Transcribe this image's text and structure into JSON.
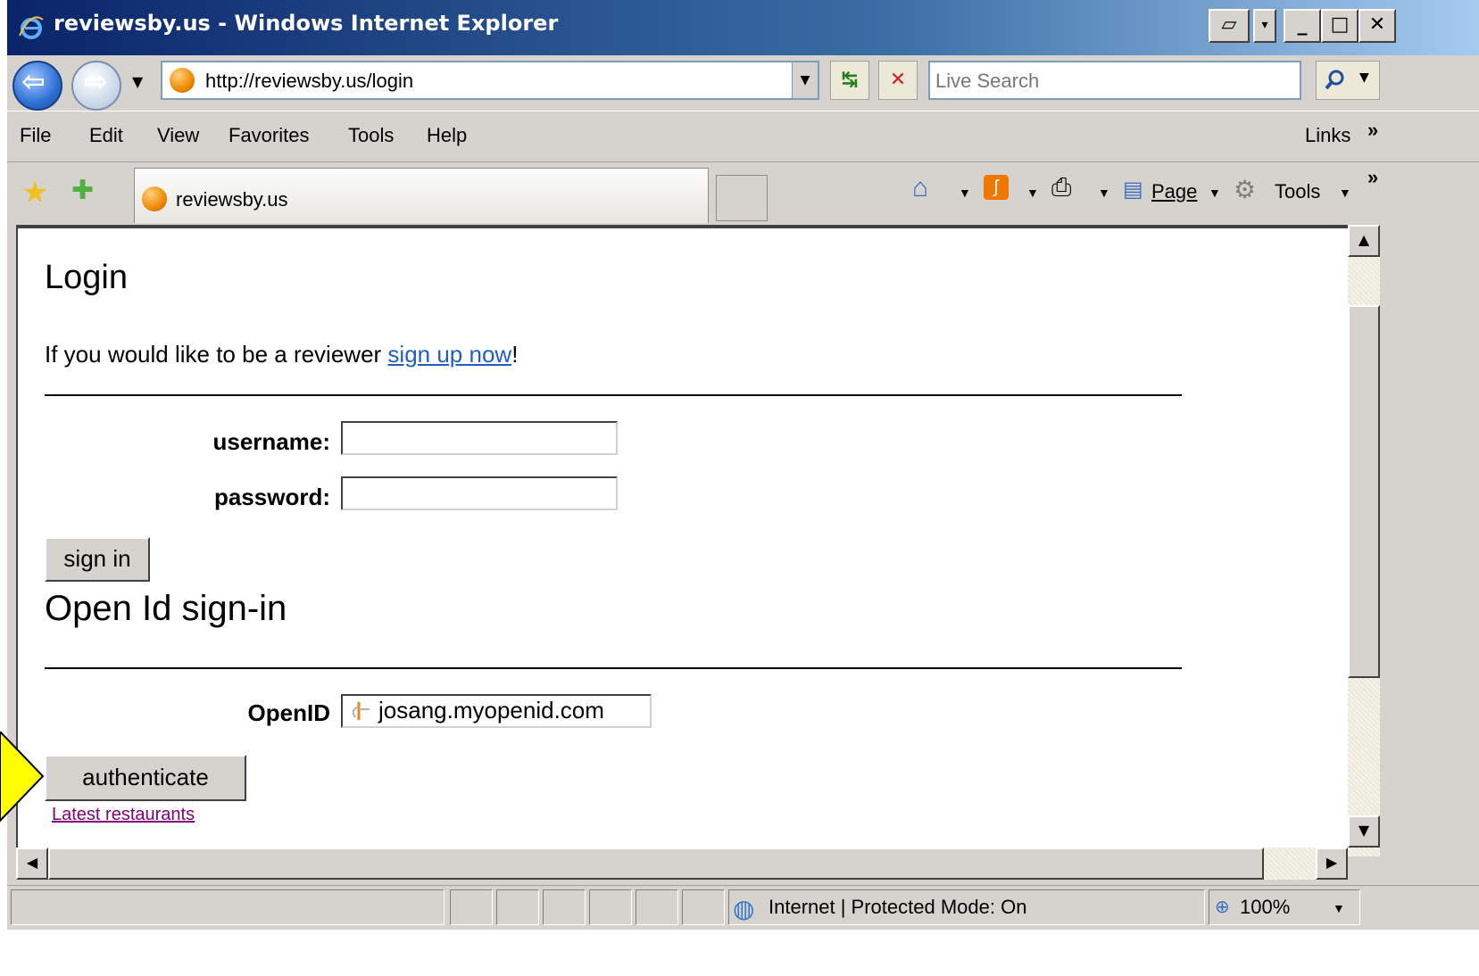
{
  "window": {
    "title": "reviewsby.us - Windows Internet Explorer"
  },
  "address_bar": {
    "url": "http://reviewsby.us/login",
    "search_placeholder": "Live Search"
  },
  "menu": {
    "items": [
      "File",
      "Edit",
      "View",
      "Favorites",
      "Tools",
      "Help"
    ],
    "links_label": "Links",
    "chevron": "»"
  },
  "tab": {
    "title": "reviewsby.us"
  },
  "command_bar": {
    "page_label": "Page",
    "tools_label": "Tools",
    "chevron": "»"
  },
  "page": {
    "heading": "Login",
    "intro_text": "If you would like to be a reviewer ",
    "signup_link": "sign up now",
    "intro_suffix": "!",
    "username_label": "username:",
    "password_label": "password:",
    "signin_button": "sign in",
    "openid_heading": "Open Id sign-in",
    "openid_label": "OpenID",
    "openid_value": "josang.myopenid.com",
    "authenticate_button": "authenticate",
    "latest_link": "Latest restaurants"
  },
  "status_bar": {
    "zone_text": "Internet | Protected Mode: On",
    "zoom": "100%"
  },
  "colors": {
    "title_gradient_start": "#0a246a",
    "link_blue": "#2060c0",
    "visited_link": "#800080",
    "callout_yellow": "#ffff00"
  }
}
